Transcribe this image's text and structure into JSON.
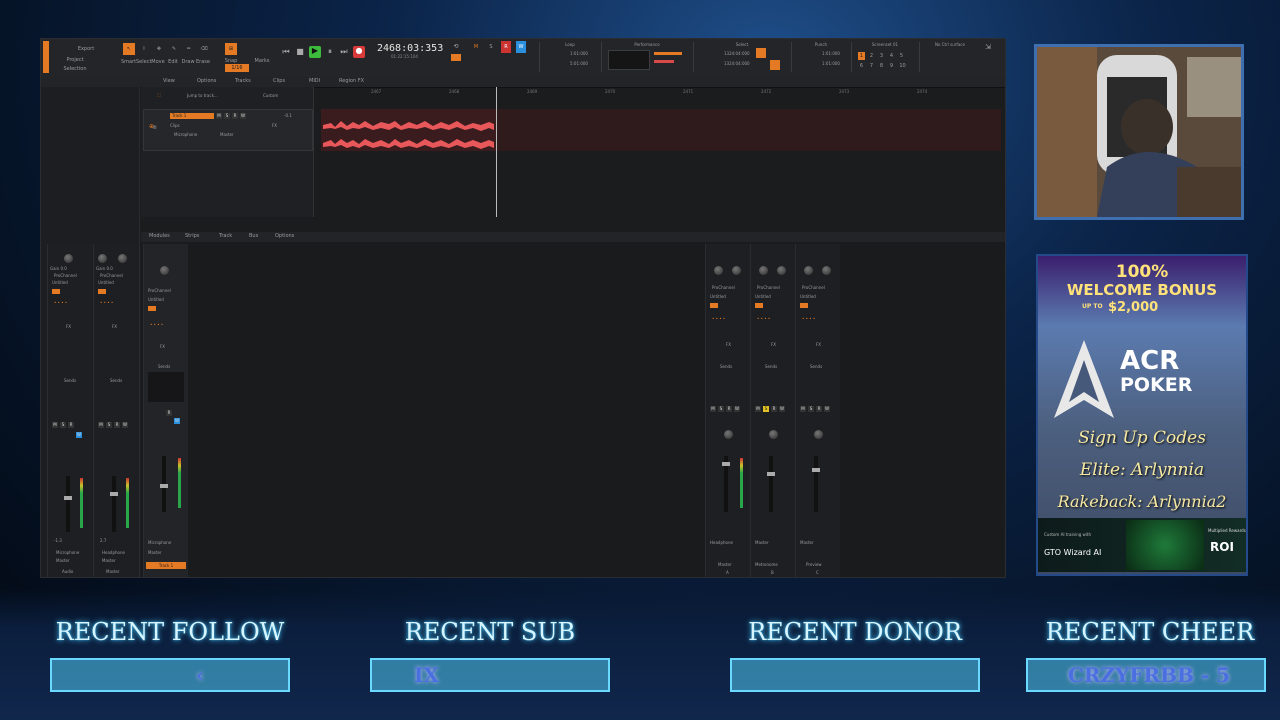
{
  "daw": {
    "control_bar": {
      "project": "Project",
      "selection": "Selection",
      "export": "Export",
      "tools": [
        "Smart",
        "Select",
        "Move",
        "Edit",
        "Draw",
        "Erase"
      ],
      "snap": "Snap",
      "snap_value": "1/16",
      "marks": "Marks",
      "timecode": "2468:03:353",
      "sub_timecode": "01:22:15:104",
      "loop_start": "1:01:000",
      "loop_end": "5:01:000",
      "module_loop": "Loop",
      "module_performance": "Performance",
      "module_select": "Select",
      "select_start": "1324:04:000",
      "select_end": "1324:04:000",
      "module_punch": "Punch",
      "punch_start": "1:01:000",
      "punch_end": "1:01:000",
      "screenset": "Screenset 01",
      "screenset_numbers": [
        "1",
        "2",
        "3",
        "4",
        "5",
        "6",
        "7",
        "8",
        "9",
        "10"
      ],
      "control_surface": "No Ctrl surface",
      "accent": "#e57a25"
    },
    "view_menu": [
      "View",
      "Options",
      "Tracks",
      "Clips",
      "MIDI",
      "Region FX"
    ],
    "track": {
      "jump": "Jump to track...",
      "preset": "Custom",
      "name": "Track 1",
      "clips": "Clips",
      "input": "Microphone",
      "output": "Master",
      "volume": "-0.1",
      "buttons": [
        "M",
        "S",
        "R",
        "W"
      ]
    },
    "ruler_ticks": [
      "2467",
      "2468",
      "2469",
      "2470",
      "2471",
      "2472",
      "2473",
      "2474"
    ],
    "clip_color": "#e8575a",
    "console_menu": [
      "Modules",
      "Strips",
      "Track",
      "Bus",
      "Options"
    ],
    "left_strips": [
      {
        "gain": "Gain 0.0",
        "pan": "Pan C",
        "prochannel": "ProChannel",
        "preset": "Untitled",
        "sends": "Sends",
        "vol": "-1.3",
        "peak": "2.7",
        "input": "Microphone",
        "output": "Master",
        "footer": "Audio"
      },
      {
        "gain": "Gain 0.0",
        "pan": "Pan C",
        "prochannel": "ProChannel",
        "preset": "Untitled",
        "sends": "Sends",
        "vol": "-0.1",
        "peak": "2.7",
        "input": "Headphone",
        "output": "Master",
        "footer": "Master"
      }
    ],
    "inspector_strip": {
      "prochannel": "ProChannel",
      "preset": "Untitled",
      "sends": "Sends",
      "input": "Microphone",
      "output": "Master",
      "name": "Track 1"
    },
    "right_strips": [
      {
        "gain": "Gain 0.0",
        "pan": "Pan C",
        "prochannel": "ProChannel",
        "preset": "Untitled",
        "sends": "Sends",
        "input": "Headphone",
        "output": "Master",
        "name": "Master",
        "letter": "A"
      },
      {
        "gain": "Gain 0.0",
        "pan": "Pan C",
        "prochannel": "ProChannel",
        "preset": "Untitled",
        "sends": "Sends",
        "input": "Master",
        "output": "Master",
        "name": "Metronome",
        "letter": "B"
      },
      {
        "gain": "Gain 0.0",
        "pan": "Pan C",
        "prochannel": "ProChannel",
        "preset": "Untitled",
        "sends": "Sends",
        "input": "Master",
        "output": "Master",
        "name": "Preview",
        "letter": "C"
      }
    ],
    "strip_buttons": [
      "M",
      "S",
      "R",
      "W"
    ],
    "fx_label": "FX"
  },
  "ad": {
    "headline": "100%",
    "headline2": "WELCOME BONUS",
    "upto": "UP TO",
    "amount": "$2,000",
    "brand1": "ACR",
    "brand2": "POKER",
    "codes_title": "Sign Up Codes",
    "elite": "Elite: Arlynnia",
    "rakeback": "Rakeback: Arlynnia2",
    "gto_text": "Custom AI training with",
    "gto_brand": "GTO Wizard AI",
    "roi_label": "Multiplied Rewards",
    "roi": "ROI"
  },
  "banners": [
    {
      "title": "RECENT FOLLOW",
      "value": "‹"
    },
    {
      "title": "RECENT SUB",
      "value": "IX"
    },
    {
      "title": "RECENT DONOR",
      "value": ""
    },
    {
      "title": "RECENT CHEER",
      "value": "CRZYFRBB - 5"
    }
  ]
}
